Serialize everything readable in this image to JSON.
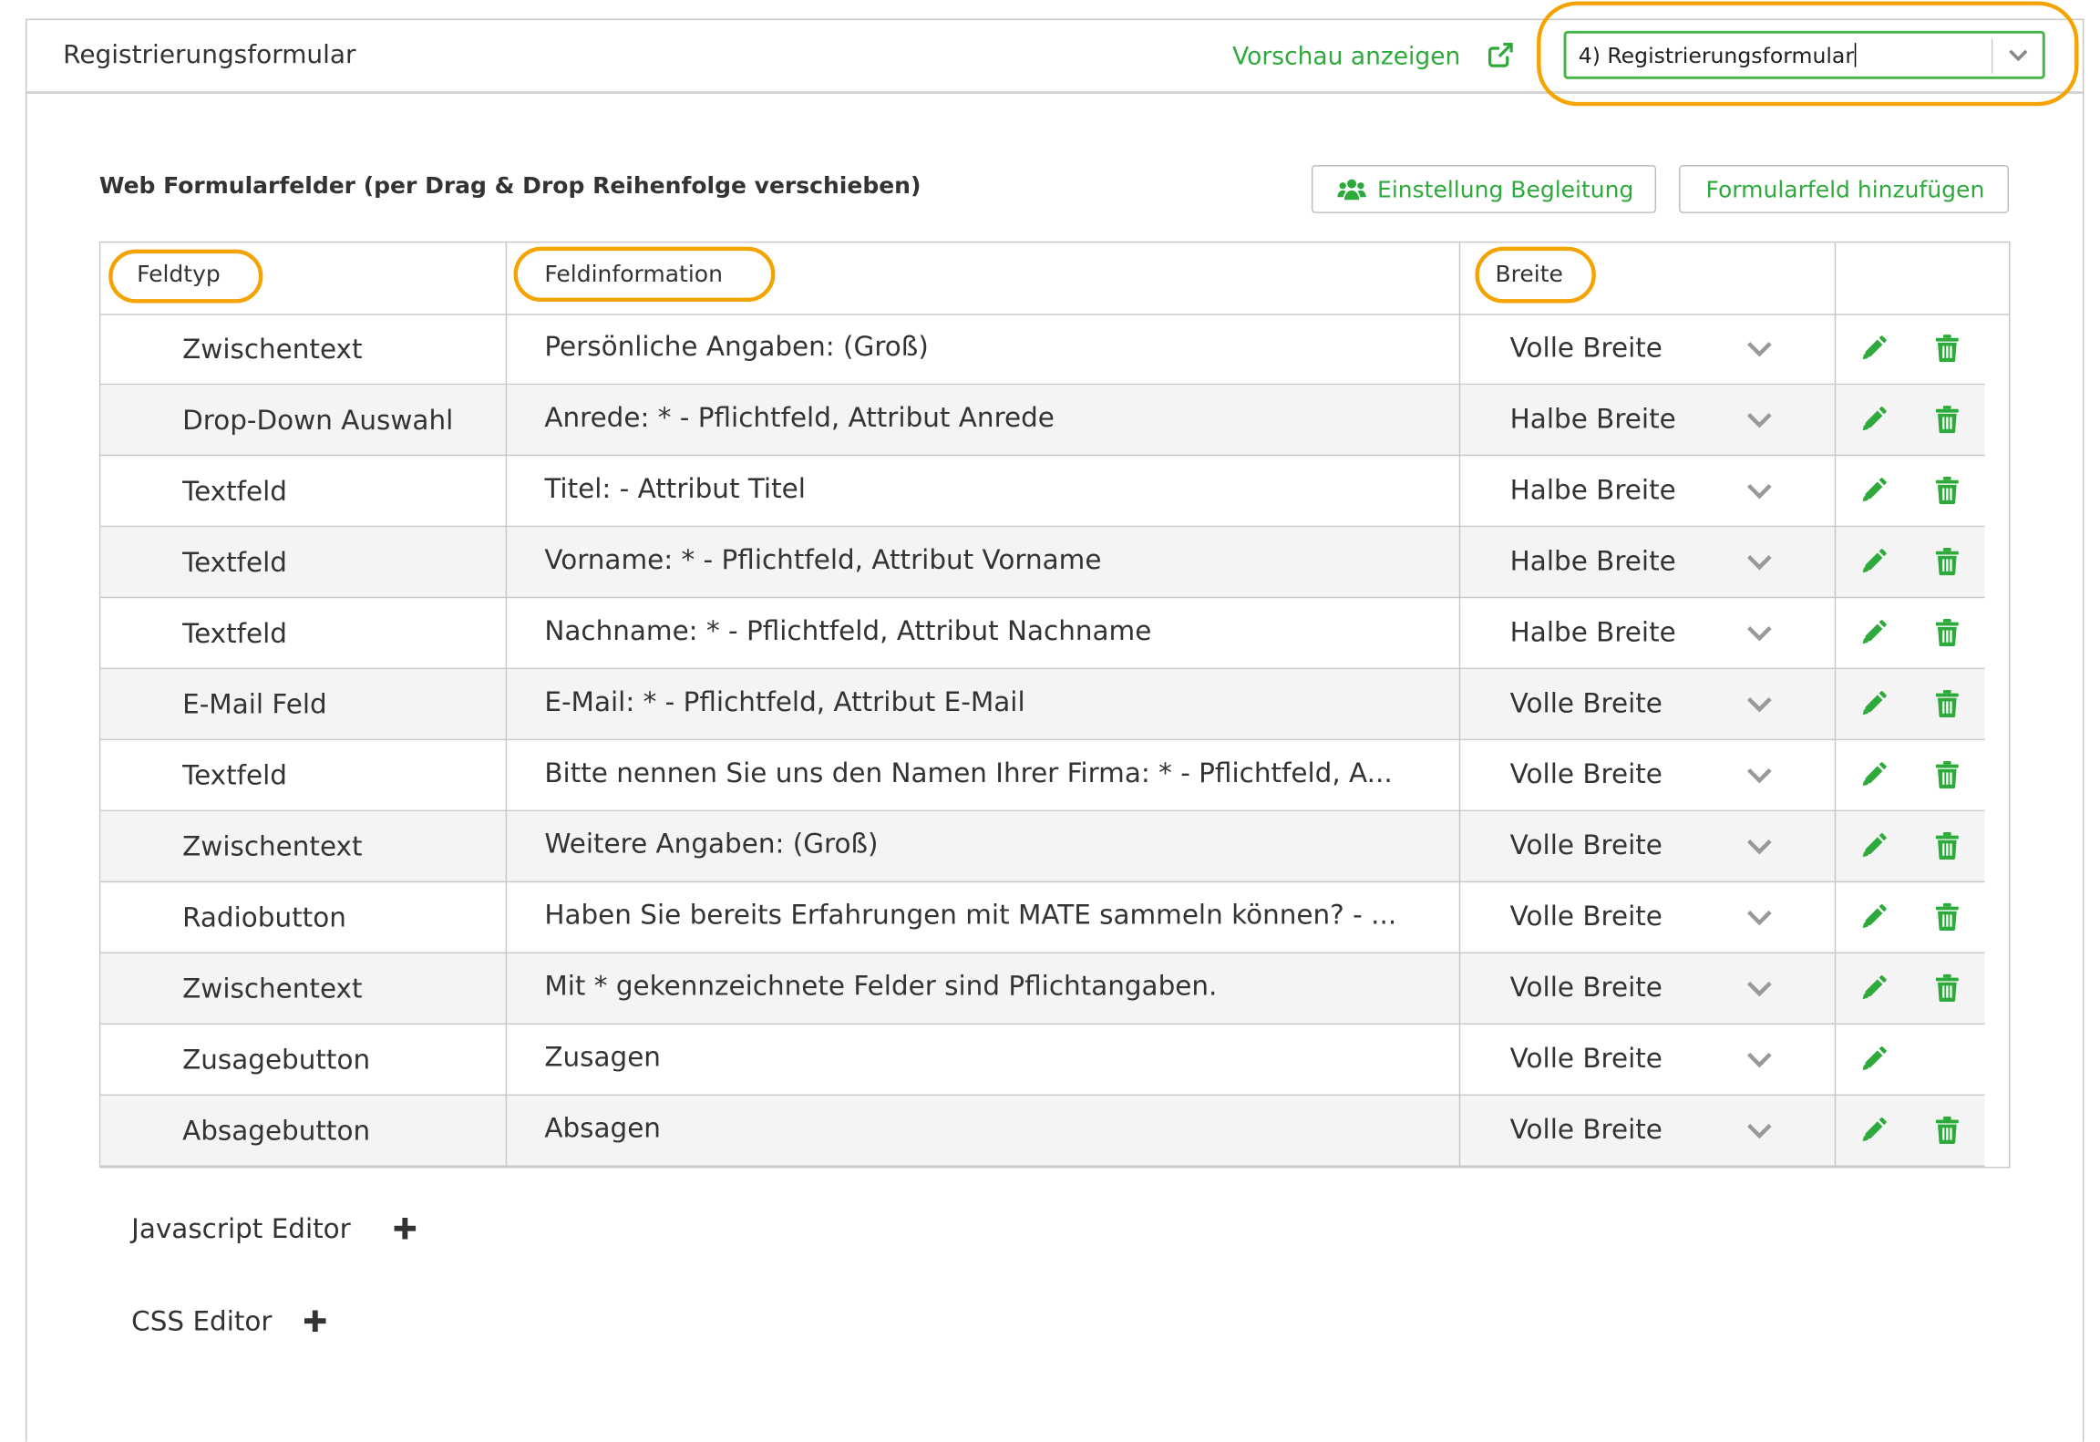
{
  "header": {
    "title": "Registrierungsformular",
    "preview_label": "Vorschau anzeigen",
    "form_select_value": "4) Registrierungsformular"
  },
  "section": {
    "title": "Web Formularfelder (per Drag & Drop Reihenfolge verschieben)",
    "btn_companion": "Einstellung Begleitung",
    "btn_add_field": "Formularfeld hinzufügen"
  },
  "table": {
    "columns": {
      "type": "Feldtyp",
      "info": "Feldinformation",
      "width": "Breite"
    },
    "rows": [
      {
        "type": "Zwischentext",
        "info": "Persönliche Angaben: (Groß)",
        "width": "Volle Breite"
      },
      {
        "type": "Drop-Down Auswahl",
        "info": "Anrede: * - Pflichtfeld, Attribut Anrede",
        "width": "Halbe Breite"
      },
      {
        "type": "Textfeld",
        "info": "Titel: - Attribut Titel",
        "width": "Halbe Breite"
      },
      {
        "type": "Textfeld",
        "info": "Vorname: * - Pflichtfeld, Attribut Vorname",
        "width": "Halbe Breite"
      },
      {
        "type": "Textfeld",
        "info": "Nachname: * - Pflichtfeld, Attribut Nachname",
        "width": "Halbe Breite"
      },
      {
        "type": "E-Mail Feld",
        "info": "E-Mail: * - Pflichtfeld, Attribut E-Mail",
        "width": "Volle Breite"
      },
      {
        "type": "Textfeld",
        "info": "Bitte nennen Sie uns den Namen Ihrer Firma: * - Pflichtfeld, A...",
        "width": "Volle Breite"
      },
      {
        "type": "Zwischentext",
        "info": "Weitere Angaben: (Groß)",
        "width": "Volle Breite"
      },
      {
        "type": "Radiobutton",
        "info": "Haben Sie bereits Erfahrungen mit MATE sammeln können? - ...",
        "width": "Volle Breite"
      },
      {
        "type": "Zwischentext",
        "info": "Mit * gekennzeichnete Felder sind Pflichtangaben.",
        "width": "Volle Breite"
      },
      {
        "type": "Zusagebutton",
        "info": "Zusagen",
        "width": "Volle Breite"
      },
      {
        "type": "Absagebutton",
        "info": "Absagen",
        "width": "Volle Breite"
      }
    ]
  },
  "editors": {
    "js_label": "Javascript Editor",
    "css_label": "CSS Editor"
  },
  "icons": [
    "external-link-icon",
    "chevron-down-icon",
    "users-icon",
    "pencil-icon",
    "trash-icon",
    "plus-icon"
  ],
  "colors": {
    "accent_green": "#2eaa3c",
    "highlight_orange": "#f4a300",
    "row_alt": "#f4f4f4"
  }
}
